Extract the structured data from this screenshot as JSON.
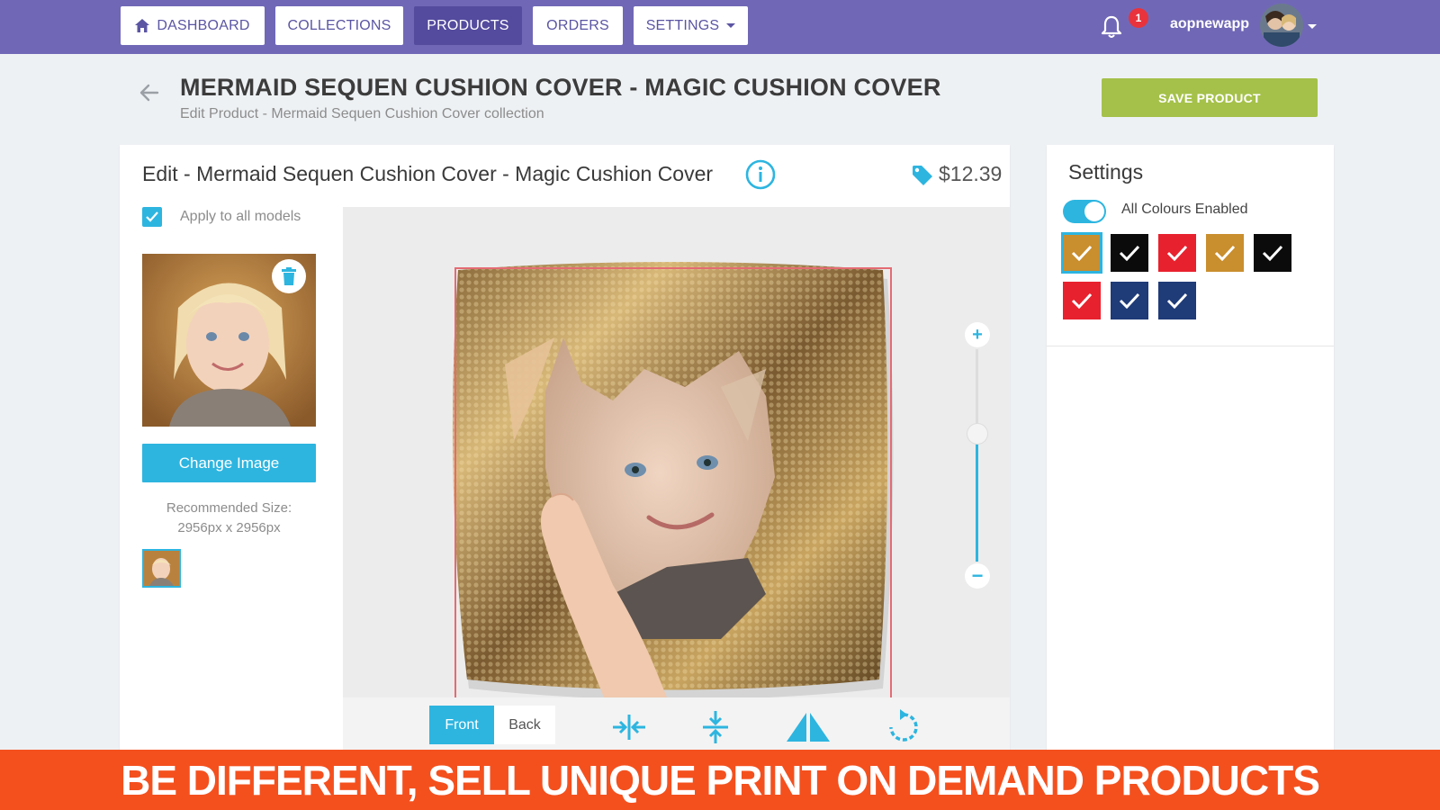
{
  "nav": {
    "dashboard": "DASHBOARD",
    "collections": "COLLECTIONS",
    "products": "PRODUCTS",
    "orders": "ORDERS",
    "settings": "SETTINGS",
    "notification_count": "1",
    "username": "aopnewapp"
  },
  "header": {
    "title": "MERMAID SEQUEN CUSHION COVER - MAGIC CUSHION COVER",
    "subtitle": "Edit Product - Mermaid Sequen Cushion Cover collection",
    "save_label": "SAVE PRODUCT"
  },
  "editor": {
    "title": "Edit - Mermaid Sequen Cushion Cover - Magic Cushion Cover",
    "price": "$12.39",
    "apply_all_label": "Apply to all models",
    "apply_all_checked": true,
    "change_image_label": "Change Image",
    "recommended_label": "Recommended Size:",
    "recommended_value": "2956px x 2956px",
    "zoom_level": 0.6,
    "sides": [
      "Front",
      "Back"
    ],
    "active_side": "Front",
    "tools": [
      "center-horizontal-icon",
      "center-vertical-icon",
      "flip-icon",
      "rotate-icon"
    ]
  },
  "settings": {
    "title": "Settings",
    "all_colours_label": "All Colours Enabled",
    "all_colours_enabled": true,
    "colours": [
      {
        "name": "gold",
        "color": "#c98e2e",
        "selected": true
      },
      {
        "name": "black",
        "color": "#0b0b0b",
        "selected": false
      },
      {
        "name": "red",
        "color": "#e8212e",
        "selected": false
      },
      {
        "name": "gold",
        "color": "#c98e2e",
        "selected": false
      },
      {
        "name": "black",
        "color": "#0b0b0b",
        "selected": false
      },
      {
        "name": "red",
        "color": "#e8212e",
        "selected": false
      },
      {
        "name": "navy",
        "color": "#1f3b78",
        "selected": false
      },
      {
        "name": "navy",
        "color": "#1f3b78",
        "selected": false
      }
    ]
  },
  "banner": {
    "text": "BE DIFFERENT, SELL UNIQUE PRINT ON DEMAND PRODUCTS"
  },
  "colors": {
    "nav_bg": "#7068b6",
    "nav_active": "#544b9e",
    "accent": "#2db5e0",
    "save_green": "#a5c14a",
    "banner_orange": "#f4501e"
  }
}
